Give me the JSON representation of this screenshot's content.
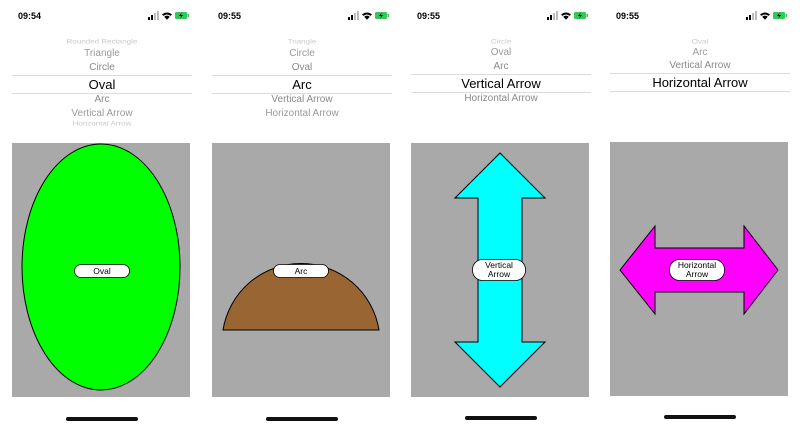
{
  "screens": [
    {
      "time": "09:54",
      "picker_items": [
        "Rounded Rectangle",
        "Triangle",
        "Circle",
        "Oval",
        "Arc",
        "Vertical Arrow",
        "Horizontal Arrow"
      ],
      "selected": "Oval",
      "shape_label": "Oval",
      "shape_color": "#00ff00"
    },
    {
      "time": "09:55",
      "picker_items": [
        "Triangle",
        "Circle",
        "Oval",
        "Arc",
        "Vertical Arrow",
        "Horizontal Arrow"
      ],
      "selected": "Arc",
      "shape_label": "Arc",
      "shape_color": "#996633"
    },
    {
      "time": "09:55",
      "picker_items": [
        "Circle",
        "Oval",
        "Arc",
        "Vertical Arrow",
        "Horizontal Arrow"
      ],
      "selected": "Vertical Arrow",
      "shape_label": "Vertical Arrow",
      "shape_color": "#00ffff"
    },
    {
      "time": "09:55",
      "picker_items": [
        "Oval",
        "Arc",
        "Vertical Arrow",
        "Horizontal Arrow"
      ],
      "selected": "Horizontal Arrow",
      "shape_label": "Horizontal Arrow",
      "shape_color": "#ff00ff"
    }
  ],
  "colors": {
    "canvas_background": "#a9a9a9",
    "battery": "#34c759"
  },
  "icons": [
    "cellular-signal-icon",
    "wifi-icon",
    "battery-charging-icon"
  ]
}
